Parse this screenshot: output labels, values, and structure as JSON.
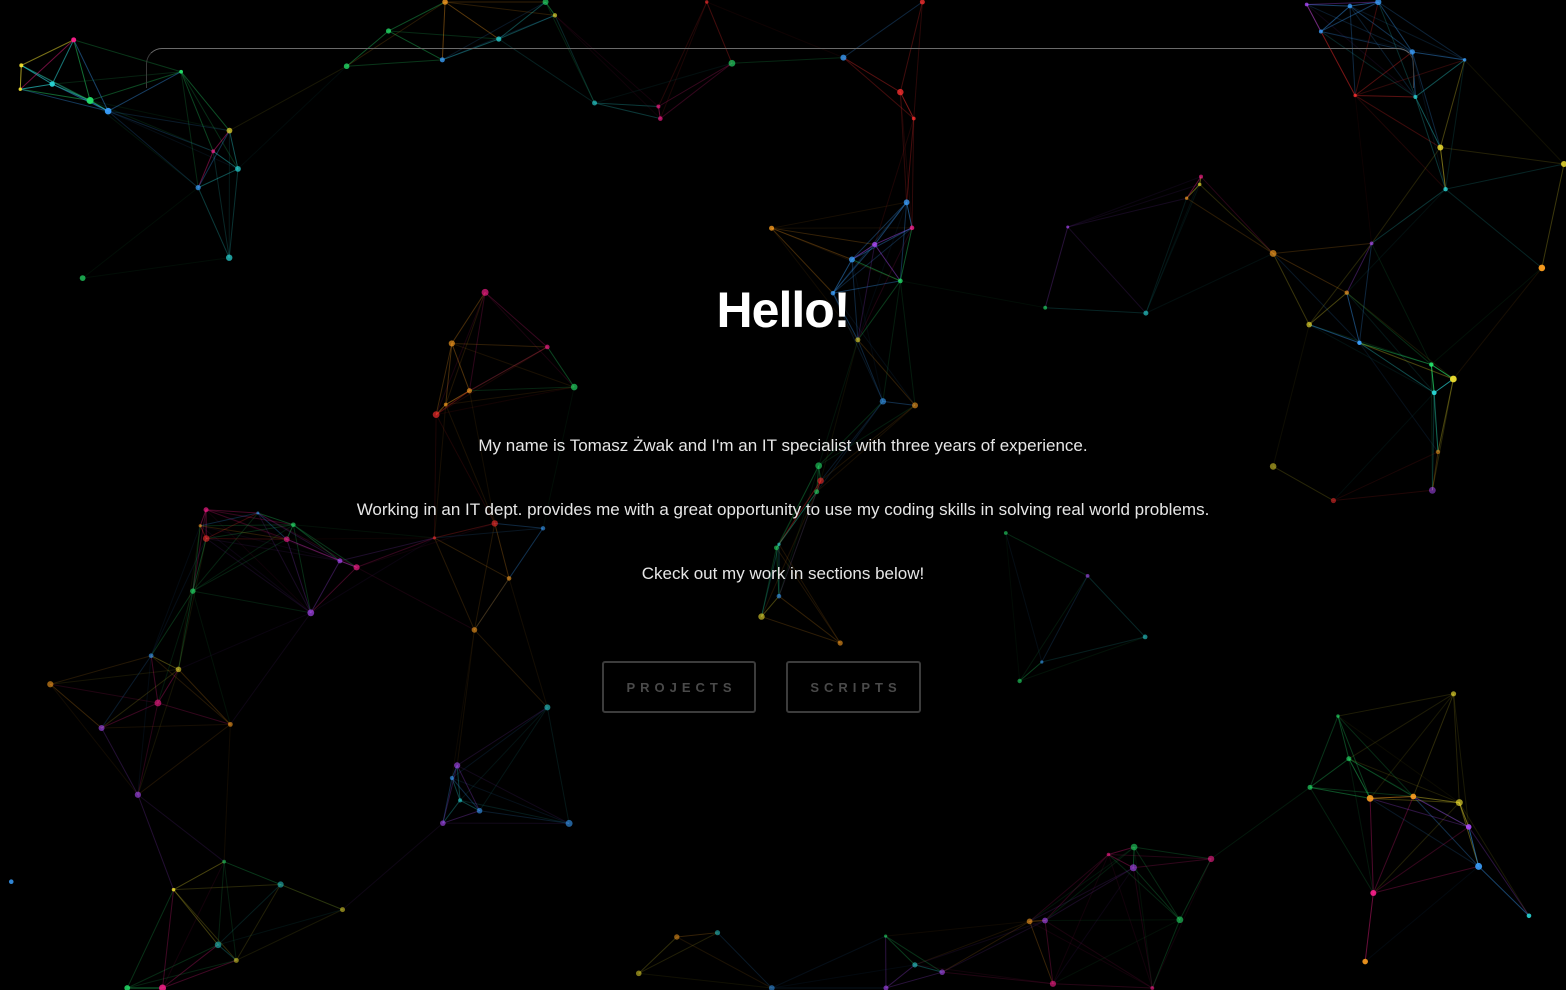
{
  "hero": {
    "title": "Hello!",
    "paragraphs": [
      "My name is Tomasz Żwak and I'm an IT specialist with three years of experience.",
      "Working in an IT dept. provides me with a great opportunity to use my coding skills in solving real world problems.",
      "Ckeck out my work in sections below!"
    ]
  },
  "nav": {
    "projects_label": "PROJECTS",
    "scripts_label": "SCRIPTS"
  },
  "colors": {
    "background": "#000000",
    "title": "#ffffff",
    "text": "#e6e6e6",
    "button_border": "#3c3c3c",
    "button_text": "#4a4a4a",
    "network_palette": [
      "#ff1f8e",
      "#ffa020",
      "#3aa0ff",
      "#25e06a",
      "#b04cff",
      "#f0e030",
      "#2ad6d6",
      "#ff3030"
    ]
  },
  "background": {
    "type": "particle-network"
  }
}
